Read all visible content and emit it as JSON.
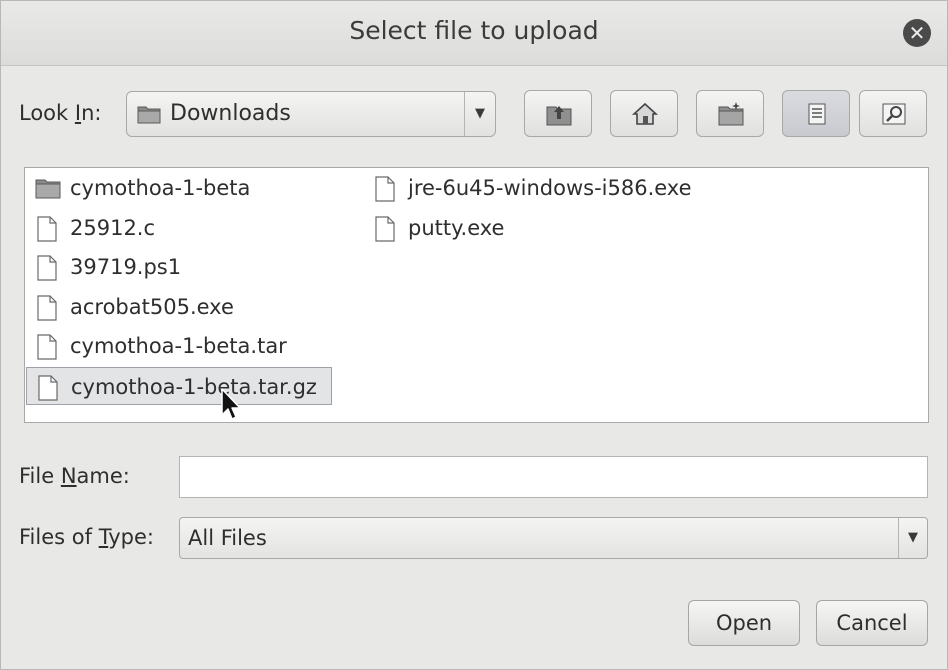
{
  "window": {
    "title": "Select file to upload",
    "close_icon": "close-icon"
  },
  "look_in": {
    "label_pre": "Look ",
    "label_mnemonic": "I",
    "label_post": "n:",
    "value": "Downloads"
  },
  "toolbar": {
    "buttons": [
      {
        "name": "up-one-level-icon"
      },
      {
        "name": "home-icon"
      },
      {
        "name": "new-folder-icon"
      },
      {
        "name": "list-view-icon",
        "active": true
      },
      {
        "name": "details-view-icon"
      }
    ]
  },
  "files": [
    {
      "name": "cymothoa-1-beta",
      "type": "folder"
    },
    {
      "name": "25912.c",
      "type": "file"
    },
    {
      "name": "39719.ps1",
      "type": "file"
    },
    {
      "name": "acrobat505.exe",
      "type": "file"
    },
    {
      "name": "cymothoa-1-beta.tar",
      "type": "file"
    },
    {
      "name": "cymothoa-1-beta.tar.gz",
      "type": "file",
      "selected": true
    },
    {
      "name": "jre-6u45-windows-i586.exe",
      "type": "file"
    },
    {
      "name": "putty.exe",
      "type": "file"
    }
  ],
  "file_name": {
    "label_pre": "File ",
    "label_mnemonic": "N",
    "label_post": "ame:",
    "value": ""
  },
  "file_type": {
    "label_pre": "Files of ",
    "label_mnemonic": "T",
    "label_post": "ype:",
    "value": "All Files"
  },
  "actions": {
    "open_label": "Open",
    "cancel_label": "Cancel"
  }
}
